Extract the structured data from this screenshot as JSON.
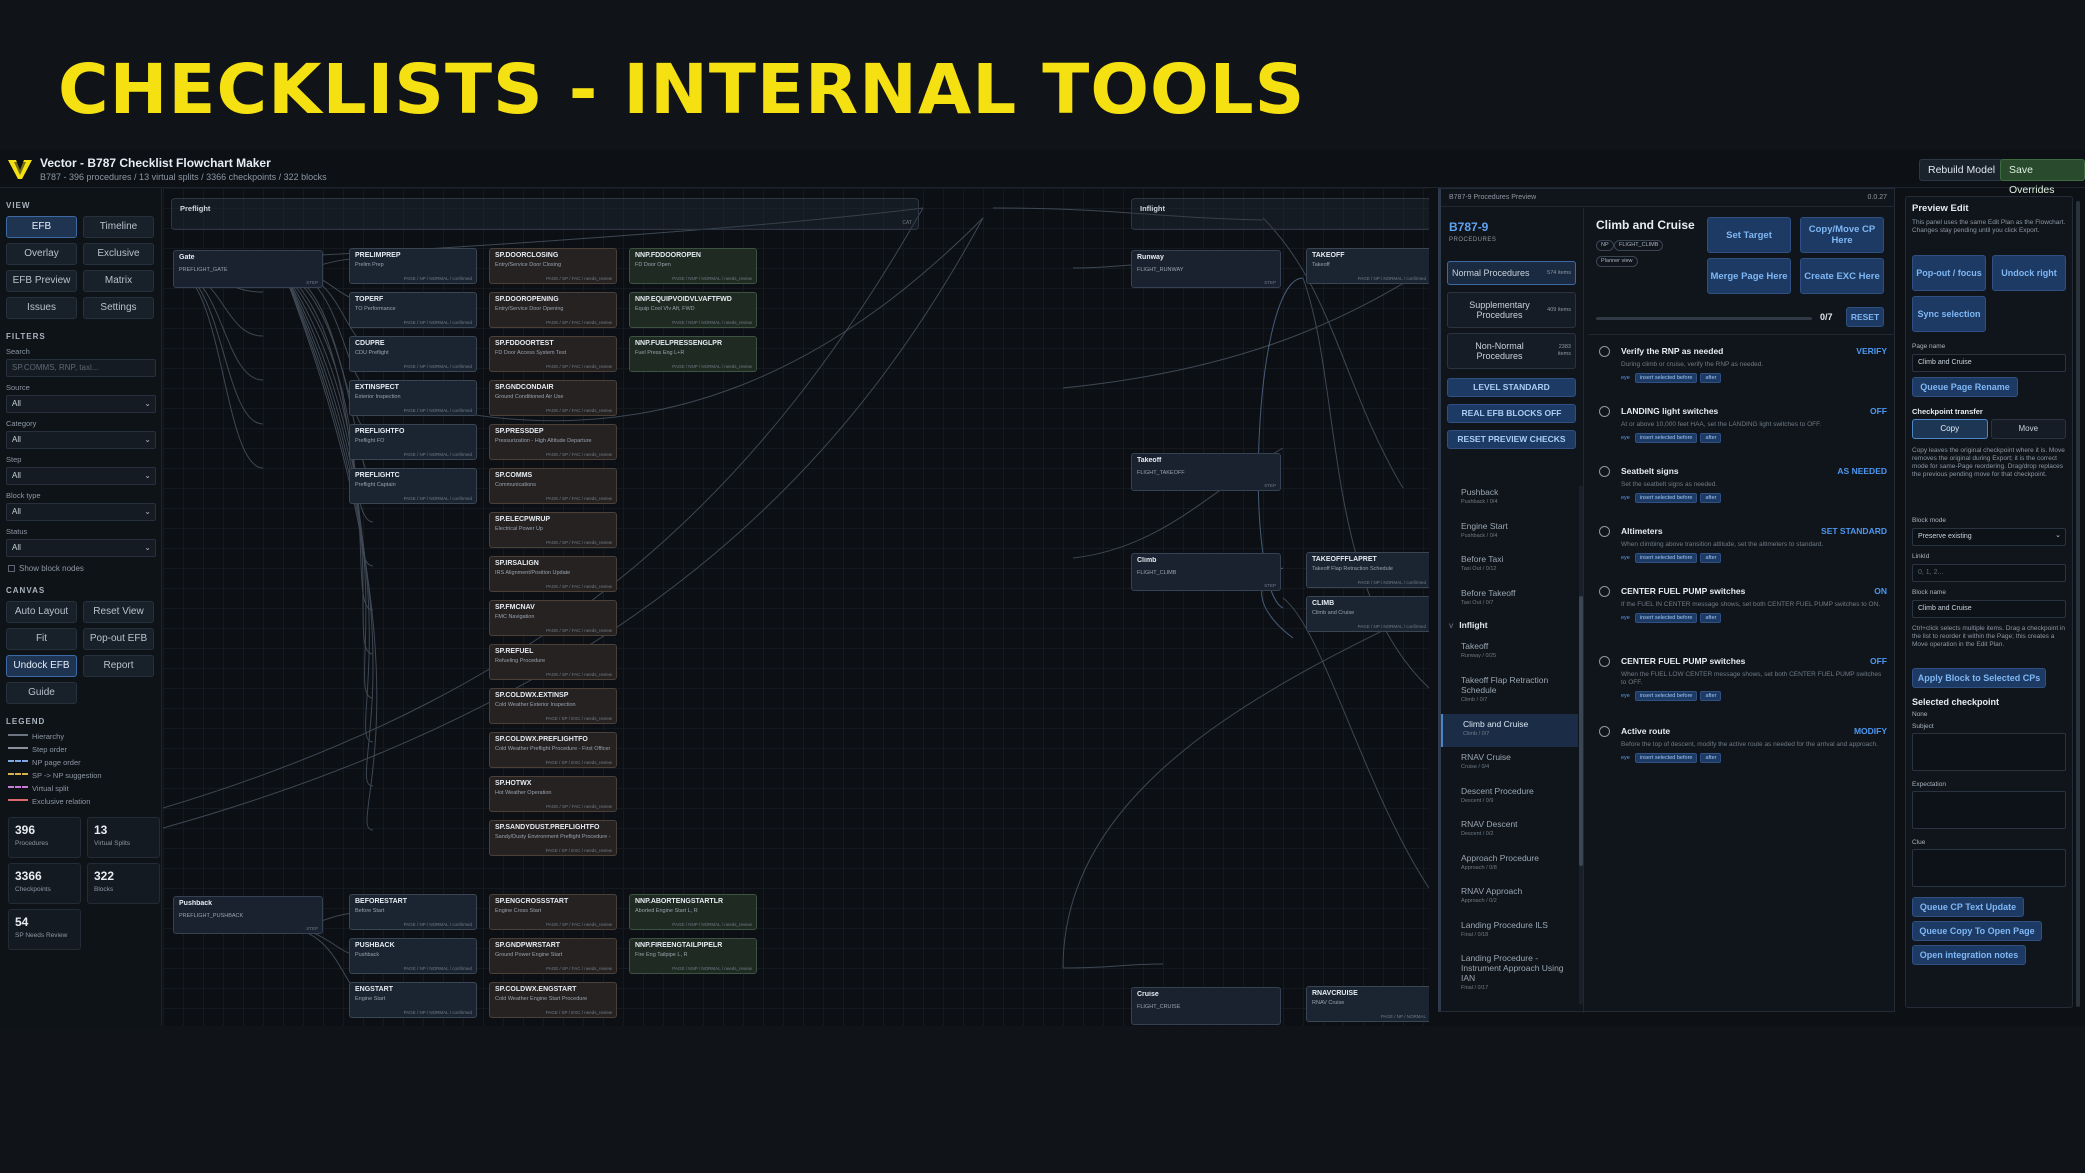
{
  "banner_title": "CHECKLISTS - INTERNAL TOOLS",
  "colors": {
    "banner_yellow": "#f5e112",
    "accent_blue": "#4d97f0",
    "bg": "#0d1116"
  },
  "app": {
    "title": "Vector - B787 Checklist Flowchart Maker",
    "subtitle": "B787 - 396 procedures / 13 virtual splits / 3366 checkpoints / 322 blocks",
    "top_buttons": [
      "Rebuild Model",
      "Save Overrides"
    ]
  },
  "sidebar": {
    "view_label": "VIEW",
    "view_buttons": [
      "EFB",
      "Timeline",
      "Overlay",
      "Exclusive",
      "EFB Preview",
      "Matrix",
      "Issues",
      "Settings"
    ],
    "filters_label": "FILTERS",
    "filters": {
      "search_label": "Search",
      "search_placeholder": "SP.COMMS, RNP, taxi...",
      "source_label": "Source",
      "source_value": "All",
      "category_label": "Category",
      "category_value": "All",
      "step_label": "Step",
      "step_value": "All",
      "blocktype_label": "Block type",
      "blocktype_value": "All",
      "status_label": "Status",
      "status_value": "All",
      "show_block_nodes": "Show block nodes"
    },
    "canvas_label": "CANVAS",
    "canvas_buttons": [
      "Auto Layout",
      "Reset View",
      "Fit",
      "Pop-out EFB",
      "Undock EFB",
      "Report",
      "Guide"
    ],
    "legend_label": "LEGEND",
    "legend": [
      {
        "label": "Hierarchy",
        "color": "#6b7480"
      },
      {
        "label": "Step order",
        "color": "#8a939d"
      },
      {
        "label": "NP page order",
        "color": "#7fa6e0"
      },
      {
        "label": "SP -> NP suggestion",
        "color": "#d9b24a"
      },
      {
        "label": "Virtual split",
        "color": "#c77dd8"
      },
      {
        "label": "Exclusive relation",
        "color": "#d86a6a"
      }
    ],
    "stats": [
      {
        "value": "396",
        "label": "Procedures"
      },
      {
        "value": "13",
        "label": "Virtual Splits"
      },
      {
        "value": "3366",
        "label": "Checkpoints"
      },
      {
        "value": "322",
        "label": "Blocks"
      },
      {
        "value": "54",
        "label": "SP Needs Review"
      }
    ]
  },
  "canvas": {
    "groups": {
      "preflight": "Preflight",
      "preflight_sub": "CAT",
      "inflight": "Inflight",
      "gate": "Gate",
      "gate_sub": "PREFLIGHT_GATE",
      "pushback": "Pushback",
      "pushback_sub": "PREFLIGHT_PUSHBACK",
      "runway": "Runway",
      "runway_sub": "FLIGHT_RUNWAY",
      "takeoff": "Takeoff",
      "takeoff_sub": "FLIGHT_TAKEOFF",
      "climb": "Climb",
      "climb_sub": "FLIGHT_CLIMB",
      "cruise": "Cruise",
      "cruise_sub": "FLIGHT_CRUISE",
      "step_tag": "STEP"
    },
    "nodes_np": [
      {
        "t": "PRELIMPREP",
        "s": "Prelim Prep",
        "m": "PAGE / NP / NORMAL / confirmed"
      },
      {
        "t": "TOPERF",
        "s": "TO Performance",
        "m": "PAGE / NP / NORMAL / confirmed"
      },
      {
        "t": "CDUPRE",
        "s": "CDU Preflight",
        "m": "PAGE / NP / NORMAL / confirmed"
      },
      {
        "t": "EXTINSPECT",
        "s": "Exterior Inspection",
        "m": "PAGE / NP / NORMAL / confirmed"
      },
      {
        "t": "PREFLIGHTFO",
        "s": "Preflight FO",
        "m": "PAGE / NP / NORMAL / confirmed"
      },
      {
        "t": "PREFLIGHTC",
        "s": "Preflight Captain",
        "m": "PAGE / NP / NORMAL / confirmed"
      }
    ],
    "nodes_sp": [
      {
        "t": "SP.DOORCLOSING",
        "s": "Entry/Service Door Closing",
        "m": "PAGE / SP / FAC / needs_review"
      },
      {
        "t": "SP.DOOROPENING",
        "s": "Entry/Service Door Opening",
        "m": "PAGE / SP / FAC / needs_review"
      },
      {
        "t": "SP.FDDOORTEST",
        "s": "FD Door Access System Test",
        "m": "PAGE / SP / FAC / needs_review"
      },
      {
        "t": "SP.GNDCONDAIR",
        "s": "Ground Conditioned Air Use",
        "m": "PAGE / SP / FAC / needs_review"
      },
      {
        "t": "SP.PRESSDEP",
        "s": "Pressurization - High Altitude Departure",
        "m": "PAGE / SP / FAC / needs_review"
      },
      {
        "t": "SP.COMMS",
        "s": "Communications",
        "m": "PAGE / SP / FAC / needs_review"
      },
      {
        "t": "SP.ELECPWRUP",
        "s": "Electrical Power Up",
        "m": "PAGE / SP / FAC / needs_review"
      },
      {
        "t": "SP.IRSALIGN",
        "s": "IRS Alignment/Position Update",
        "m": "PAGE / SP / FAC / needs_review"
      },
      {
        "t": "SP.FMCNAV",
        "s": "FMC Navigation",
        "m": "PAGE / SP / FAC / needs_review"
      },
      {
        "t": "SP.REFUEL",
        "s": "Refueling Procedure",
        "m": "PAGE / SP / FAC / needs_review"
      },
      {
        "t": "SP.COLDWX.EXTINSP",
        "s": "Cold Weather Exterior Inspection",
        "m": "PAGE / SP / EXC / needs_review"
      },
      {
        "t": "SP.COLDWX.PREFLIGHTFO",
        "s": "Cold Weather Preflight Procedure - First Officer",
        "m": "PAGE / SP / EXC / needs_review"
      },
      {
        "t": "SP.HOTWX",
        "s": "Hot Weather Operation",
        "m": "PAGE / SP / FAC / needs_review"
      },
      {
        "t": "SP.SANDYDUST.PREFLIGHTFO",
        "s": "Sandy/Dusty Environment Preflight Procedure - First Officer",
        "m": "PAGE / SP / EXC / needs_review"
      }
    ],
    "nodes_nnp": [
      {
        "t": "NNP.FDDOOROPEN",
        "s": "FD Door Open",
        "m": "PAGE / NNP / NORMAL / needs_review"
      },
      {
        "t": "NNP.EQUIPVOIDVLVAFTFWD",
        "s": "Equip Cool Vlv Aft, FWD",
        "m": "PAGE / NNP / NORMAL / needs_review"
      },
      {
        "t": "NNP.FUELPRESSENGLPR",
        "s": "Fuel Press Eng L+R",
        "m": "PAGE / NNP / NORMAL / needs_review"
      }
    ],
    "nodes_push": [
      {
        "t": "BEFORESTART",
        "s": "Before Start",
        "m": "PAGE / NP / NORMAL / confirmed",
        "k": "np"
      },
      {
        "t": "PUSHBACK",
        "s": "Pushback",
        "m": "PAGE / NP / NORMAL / confirmed",
        "k": "np"
      },
      {
        "t": "ENGSTART",
        "s": "Engine Start",
        "m": "PAGE / NP / NORMAL / confirmed",
        "k": "np"
      },
      {
        "t": "SP.ENGCROSSSTART",
        "s": "Engine Cross Start",
        "m": "PAGE / SP / FAC / needs_review",
        "k": "sp"
      },
      {
        "t": "SP.GNDPWRSTART",
        "s": "Ground Power Engine Start",
        "m": "PAGE / SP / FAC / needs_review",
        "k": "sp"
      },
      {
        "t": "SP.COLDWX.ENGSTART",
        "s": "Cold Weather Engine Start Procedure",
        "m": "PAGE / SP / EXC / needs_review",
        "k": "sp"
      },
      {
        "t": "NNP.ABORTENGSTARTLR",
        "s": "Aborted Engine Start L, R",
        "m": "PAGE / NNP / NORMAL / needs_review",
        "k": "nnp"
      },
      {
        "t": "NNP.FIREENGTAILPIPELR",
        "s": "Fire Eng Tailpipe L, R",
        "m": "PAGE / NNP / NORMAL / needs_review",
        "k": "nnp"
      }
    ],
    "nodes_inflight": [
      {
        "t": "TAKEOFF",
        "s": "Takeoff",
        "m": "PAGE / NP / NORMAL / confirmed"
      },
      {
        "t": "TAKEOFFFLAPRET",
        "s": "Takeoff Flap Retraction Schedule",
        "m": "PAGE / NP / NORMAL / confirmed"
      },
      {
        "t": "CLIMB",
        "s": "Climb and Cruise",
        "m": "PAGE / NP / NORMAL / confirmed"
      },
      {
        "t": "RNAVCRUISE",
        "s": "RNAV Cruise",
        "m": "PAGE / NP / NORMAL"
      }
    ]
  },
  "preview": {
    "header": "B787-9 Procedures Preview",
    "version": "0.0.27",
    "model": "B787-9",
    "model_sub": "PROCEDURES",
    "categories": [
      {
        "label": "Normal Procedures",
        "count": "574 items"
      },
      {
        "label": "Supplementary Procedures",
        "count": "409 items"
      },
      {
        "label": "Non-Normal Procedures",
        "count": "2383 items"
      }
    ],
    "actions": [
      "LEVEL STANDARD",
      "REAL EFB BLOCKS OFF",
      "RESET PREVIEW CHECKS"
    ],
    "list_pre": [
      {
        "a": "Pushback",
        "b": "Pushback / 0/4"
      },
      {
        "a": "Engine Start",
        "b": "Pushback / 0/4"
      },
      {
        "a": "Before Taxi",
        "b": "Taxi Out / 0/12"
      },
      {
        "a": "Before Takeoff",
        "b": "Taxi Out / 0/7"
      }
    ],
    "group_caret": "v",
    "group_inflight": "Inflight",
    "list_inflight": [
      {
        "a": "Takeoff",
        "b": "Runway / 0/25"
      },
      {
        "a": "Takeoff Flap Retraction Schedule",
        "b": "Climb / 0/7"
      },
      {
        "a": "Climb and Cruise",
        "b": "Climb / 0/7"
      },
      {
        "a": "RNAV Cruise",
        "b": "Cruise / 0/4"
      },
      {
        "a": "Descent Procedure",
        "b": "Descent / 0/9"
      },
      {
        "a": "RNAV Descent",
        "b": "Descent / 0/2"
      },
      {
        "a": "Approach Procedure",
        "b": "Approach / 0/8"
      },
      {
        "a": "RNAV Approach",
        "b": "Approach / 0/2"
      },
      {
        "a": "Landing Procedure ILS",
        "b": "Final / 0/18"
      },
      {
        "a": "Landing Procedure - Instrument Approach Using IAN",
        "b": "Final / 0/17"
      }
    ],
    "page_title": "Climb and Cruise",
    "tags": [
      "NP",
      "FLIGHT_CLIMB",
      "Planner view"
    ],
    "buttons": [
      "Set Target",
      "Copy/Move CP Here",
      "Merge Page Here",
      "Create EXC Here"
    ],
    "progress_text": "0/7",
    "progress_value": 0,
    "reset": "RESET",
    "checkpoints": [
      {
        "h": "Verify the RNP as needed",
        "r": "VERIFY",
        "d": "During climb or cruise, verify the RNP as needed."
      },
      {
        "h": "LANDING light switches",
        "r": "OFF",
        "d": "At or above 10,000 feet HAA, set the LANDING light switches to OFF."
      },
      {
        "h": "Seatbelt signs",
        "r": "AS NEEDED",
        "d": "Set the seatbelt signs as needed."
      },
      {
        "h": "Altimeters",
        "r": "SET STANDARD",
        "d": "When climbing above transition altitude, set the altimeters to standard."
      },
      {
        "h": "CENTER FUEL PUMP switches",
        "r": "ON",
        "d": "If the FUEL IN CENTER message shows, set both CENTER FUEL PUMP switches to ON."
      },
      {
        "h": "CENTER FUEL PUMP switches",
        "r": "OFF",
        "d": "When the FUEL LOW CENTER message shows, set both CENTER FUEL PUMP switches to OFF."
      },
      {
        "h": "Active route",
        "r": "MODIFY",
        "d": "Before the top of descent, modify the active route as needed for the arrival and approach."
      }
    ],
    "cp_eye": "eye",
    "cp_chip1": "insert selected before",
    "cp_chip2": "after"
  },
  "edit": {
    "title": "Preview Edit",
    "desc": "This panel uses the same Edit Plan as the Flowchart. Changes stay pending until you click Export.",
    "btn_popout": "Pop-out / focus",
    "btn_undock": "Undock right",
    "btn_sync": "Sync selection",
    "page_name_label": "Page name",
    "page_name_value": "Climb and Cruise",
    "queue_rename": "Queue Page Rename",
    "transfer_label": "Checkpoint transfer",
    "copy": "Copy",
    "move": "Move",
    "transfer_desc": "Copy leaves the original checkpoint where it is. Move removes the original during Export; it is the correct mode for same-Page reordering. Drag/drop replaces the previous pending move for that checkpoint.",
    "block_mode_label": "Block mode",
    "block_mode_value": "Preserve existing",
    "linkid_label": "LinkId",
    "linkid_placeholder": "0, 1, 2...",
    "block_name_label": "Block name",
    "block_name_value": "Climb and Cruise",
    "ctrl_desc": "Ctrl+click selects multiple items. Drag a checkpoint in the list to reorder it within the Page; this creates a Move operation in the Edit Plan.",
    "apply_block": "Apply Block to Selected CPs",
    "selected_cp_label": "Selected checkpoint",
    "selected_cp_value": "None",
    "subject_label": "Subject",
    "expectation_label": "Expectation",
    "clue_label": "Clue",
    "queue_cp_text": "Queue CP Text Update",
    "queue_copy": "Queue Copy To Open Page",
    "open_notes": "Open integration notes"
  }
}
